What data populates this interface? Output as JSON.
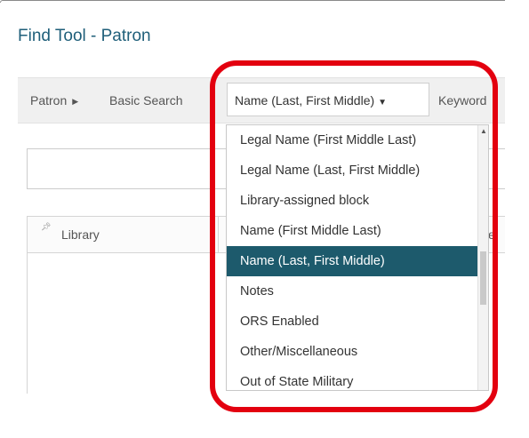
{
  "page": {
    "title": "Find Tool - Patron"
  },
  "toolbar": {
    "patron_label": "Patron",
    "basic_search_label": "Basic Search",
    "select_value": "Name (Last, First Middle)",
    "keyword_label": "Keyword"
  },
  "grid": {
    "columns": [
      "Library",
      "e"
    ]
  },
  "dropdown": {
    "options": [
      "Legal Name (First Middle Last)",
      "Legal Name (Last, First Middle)",
      "Library-assigned block",
      "Name (First Middle Last)",
      "Name (Last, First Middle)",
      "Notes",
      "ORS Enabled",
      "Other/Miscellaneous",
      "Out of State Military"
    ],
    "selected": "Name (Last, First Middle)"
  },
  "colors": {
    "title": "#1f5f7a",
    "selected_option_bg": "#1d5a6c",
    "highlight_ring": "#e3000f"
  }
}
